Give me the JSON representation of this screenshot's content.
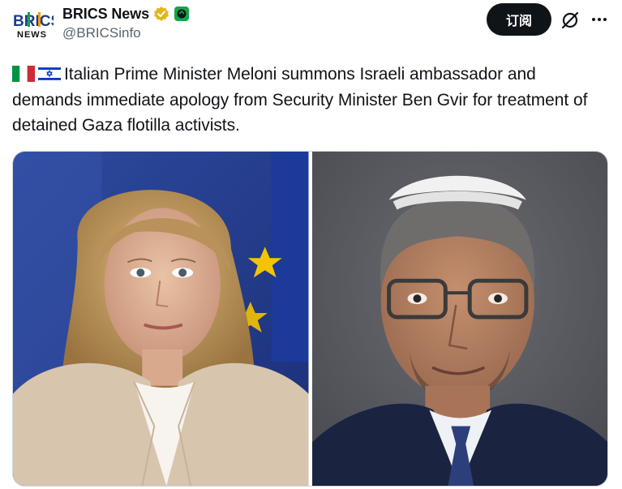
{
  "author": {
    "display_name": "BRICS News",
    "handle": "@BRICSinfo",
    "avatar_text_top": "BRICS",
    "avatar_text_bottom": "NEWS"
  },
  "actions": {
    "subscribe_label": "订阅",
    "grok_icon": "grok-slash-circle-icon",
    "more_icon": "more-horizontal-icon"
  },
  "tweet": {
    "flags": [
      "italy-flag",
      "israel-flag"
    ],
    "text": "Italian Prime Minister Meloni summons Israeli ambassador and demands immediate apology from Security Minister Ben Gvir for treatment of detained Gaza flotilla activists."
  },
  "media": {
    "photos": [
      {
        "subject": "woman-portrait-eu-flag-background"
      },
      {
        "subject": "man-portrait-kippah-glasses"
      }
    ]
  },
  "colors": {
    "verified_badge": "#e2b719",
    "subscribe_bg": "#0f1419",
    "secondary_text": "#536471"
  }
}
